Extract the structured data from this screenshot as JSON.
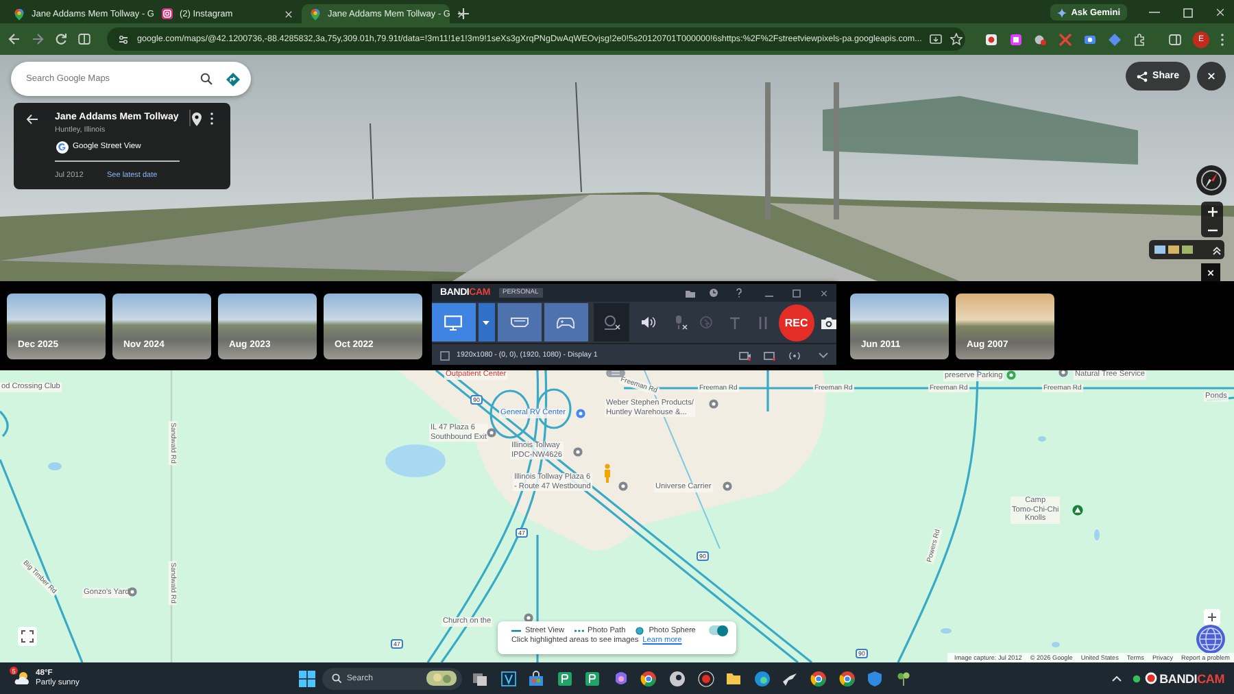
{
  "browser": {
    "tabs": [
      {
        "title": "Jane Addams Mem Tollway - G",
        "kind": "maps",
        "selected": false
      },
      {
        "title": "(2) Instagram",
        "kind": "instagram",
        "selected": false
      },
      {
        "title": "Jane Addams Mem Tollway - G",
        "kind": "maps",
        "selected": true
      }
    ],
    "ask_gemini": "Ask Gemini",
    "url": "google.com/maps/@42.1200736,-88.4285832,3a,75y,309.01h,79.91t/data=!3m11!1e1!3m9!1seXs3gXrqPNgDwAqWEOvjsg!2e0!5s20120701T000000!6shttps:%2F%2Fstreetviewpixels-pa.googleapis.com...",
    "profile_initial": "E"
  },
  "street_view": {
    "search": {
      "placeholder": "Search Google Maps"
    },
    "place": {
      "title": "Jane Addams Mem Tollway",
      "subtitle": "Huntley, Illinois",
      "source": "Google Street View",
      "date": "Jul 2012",
      "latest_link": "See latest date"
    },
    "share": "Share"
  },
  "timeline": [
    {
      "date": "Dec 2025"
    },
    {
      "date": "Nov 2024"
    },
    {
      "date": "Aug 2023"
    },
    {
      "date": "Oct 2022"
    },
    {
      "date": "Jun 2011"
    },
    {
      "date": "Aug 2007"
    }
  ],
  "bandicam": {
    "logo_a": "BANDI",
    "logo_b": "CAM",
    "edition": "PERSONAL",
    "rec": "REC",
    "area": "1920x1080 - (0, 0), (1920, 1080) - Display 1"
  },
  "map": {
    "labels": [
      {
        "lines": [
          "od Crossing Club"
        ],
        "kind": "place"
      },
      {
        "lines": [
          "Outpatient Center"
        ],
        "kind": "health"
      },
      {
        "lines": [
          "Freeman Rd"
        ],
        "kind": "road"
      },
      {
        "lines": [
          "Freeman Rd"
        ],
        "kind": "road"
      },
      {
        "lines": [
          "Freeman Rd"
        ],
        "kind": "road"
      },
      {
        "lines": [
          "Freeman Rd"
        ],
        "kind": "road"
      },
      {
        "lines": [
          "Freeman Rd"
        ],
        "kind": "road"
      },
      {
        "lines": [
          "General RV Center"
        ],
        "kind": "shop"
      },
      {
        "lines": [
          "Weber Stephen Products/",
          "Huntley Warehouse &..."
        ],
        "kind": "place"
      },
      {
        "lines": [
          "IL 47 Plaza 6",
          "Southbound Exit"
        ],
        "kind": "place"
      },
      {
        "lines": [
          "Illinois Tollway",
          "IPDC-NW4626"
        ],
        "kind": "place"
      },
      {
        "lines": [
          "Illinois Tollway Plaza 6",
          "- Route 47 Westbound"
        ],
        "kind": "place"
      },
      {
        "lines": [
          "Universe Carrier"
        ],
        "kind": "place"
      },
      {
        "lines": [
          "Camp",
          "Tomo-Chi-Chi",
          "Knolls"
        ],
        "kind": "place"
      },
      {
        "lines": [
          "Gonzo's Yard"
        ],
        "kind": "place"
      },
      {
        "lines": [
          "Church on the"
        ],
        "kind": "place"
      },
      {
        "lines": [
          "preserve Parking"
        ],
        "kind": "place"
      },
      {
        "lines": [
          "Natural Tree Service"
        ],
        "kind": "place"
      },
      {
        "lines": [
          "Ponds"
        ],
        "kind": "place"
      },
      {
        "lines": [
          "Sandwald Rd"
        ],
        "kind": "road"
      },
      {
        "lines": [
          "Sandwald Rd"
        ],
        "kind": "road"
      },
      {
        "lines": [
          "Big Timber Rd"
        ],
        "kind": "road"
      },
      {
        "lines": [
          "Powers Rd"
        ],
        "kind": "road"
      },
      {
        "lines": [
          "90"
        ],
        "kind": "shield"
      },
      {
        "lines": [
          "47"
        ],
        "kind": "shield"
      },
      {
        "lines": [
          "90"
        ],
        "kind": "shield"
      },
      {
        "lines": [
          "47"
        ],
        "kind": "shield"
      },
      {
        "lines": [
          "90"
        ],
        "kind": "shield"
      }
    ],
    "legend": {
      "items": [
        {
          "label": "Street View",
          "kind": "line"
        },
        {
          "label": "Photo Path",
          "kind": "dotted"
        },
        {
          "label": "Photo Sphere",
          "kind": "dot"
        }
      ],
      "hint": "Click highlighted areas to see images",
      "link": "Learn more",
      "on": true
    },
    "attribution": [
      "Image capture: Jul 2012",
      "© 2026 Google",
      "United States",
      "Terms",
      "Privacy",
      "Report a problem"
    ]
  },
  "taskbar": {
    "weather": {
      "badge": "5",
      "temperature": "48°F",
      "condition": "Partly sunny"
    },
    "search": {
      "placeholder": "Search"
    },
    "tray_logo_a": "BANDI",
    "tray_logo_b": "CAM"
  }
}
